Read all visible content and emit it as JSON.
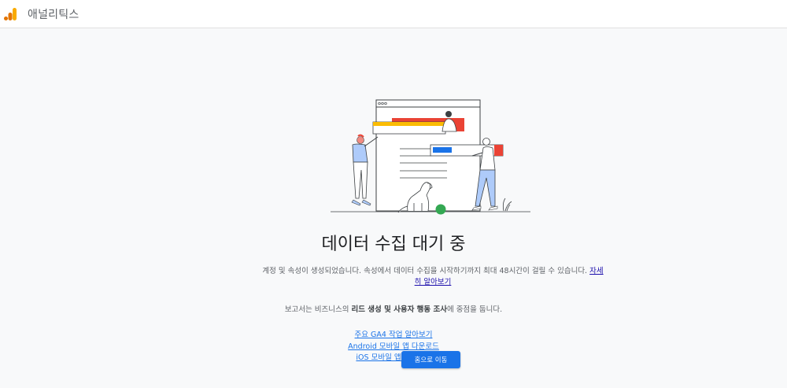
{
  "app": {
    "title": "애널리틱스"
  },
  "main": {
    "heading": "데이터 수집 대기 중",
    "description": "계정 및 속성이 생성되었습니다. 속성에서 데이터 수집을 시작하기까지 최대 48시간이 걸릴 수 있습니다.",
    "learn_more": "자세히 알아보기",
    "focus_prefix": "보고서는 비즈니스의 ",
    "focus_bold": "리드 생성 및 사용자 행동 조사",
    "focus_suffix": "에 중점을 둡니다.",
    "links": [
      "주요 GA4 작업 알아보기",
      "Android 모바일 앱 다운로드",
      "iOS 모바일 앱 다운로드"
    ],
    "home_button": "홈으로 이동"
  },
  "colors": {
    "brand_orange": "#f9ab00",
    "brand_dark_orange": "#e37400",
    "primary_blue": "#1a73e8",
    "illustration_red": "#ea4335",
    "illustration_yellow": "#fbbc04",
    "illustration_green": "#34a853"
  }
}
